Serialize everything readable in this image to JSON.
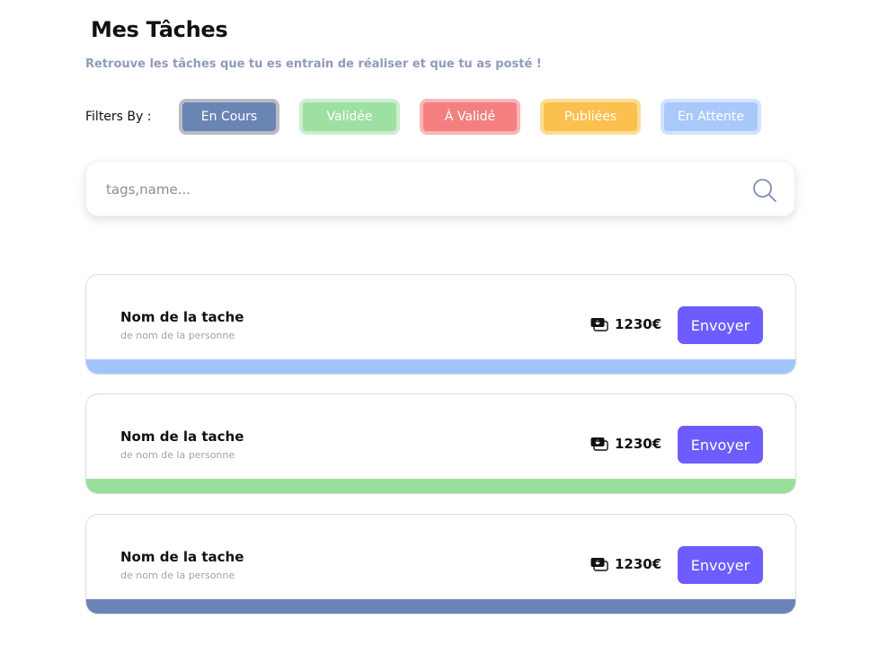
{
  "header": {
    "title": "Mes Tâches",
    "subtitle": "Retrouve les tâches que tu es entrain de réaliser et que tu as posté !"
  },
  "filters": {
    "label": "Filters By :",
    "chips": [
      {
        "label": "En Cours",
        "bg": "#6a84b4",
        "border": "#b9bcc5",
        "active": true
      },
      {
        "label": "Validée",
        "bg": "#9ee0a1",
        "border": "#cdeecf",
        "active": false
      },
      {
        "label": "À Validé",
        "bg": "#f47f7f",
        "border": "#f8b6b8",
        "active": false
      },
      {
        "label": "Publiées",
        "bg": "#fbc04d",
        "border": "#fbdd97",
        "active": false
      },
      {
        "label": "En Attente",
        "bg": "#a9c9fb",
        "border": "#d2e3fd",
        "active": false
      }
    ]
  },
  "search": {
    "placeholder": "tags,name...",
    "value": "",
    "icon": "search-icon"
  },
  "tasks": [
    {
      "name": "Nom de la tache",
      "person": "de nom de la personne",
      "amount": "1230€",
      "button_label": "Envoyer",
      "status_color": "#a1c5fb"
    },
    {
      "name": "Nom de la tache",
      "person": "de nom de la personne",
      "amount": "1230€",
      "button_label": "Envoyer",
      "status_color": "#99df9c"
    },
    {
      "name": "Nom de la tache",
      "person": "de nom de la personne",
      "amount": "1230€",
      "button_label": "Envoyer",
      "status_color": "#6a84b4"
    }
  ],
  "colors": {
    "accent": "#6d5cff",
    "subtitle": "#8f9bb8"
  }
}
